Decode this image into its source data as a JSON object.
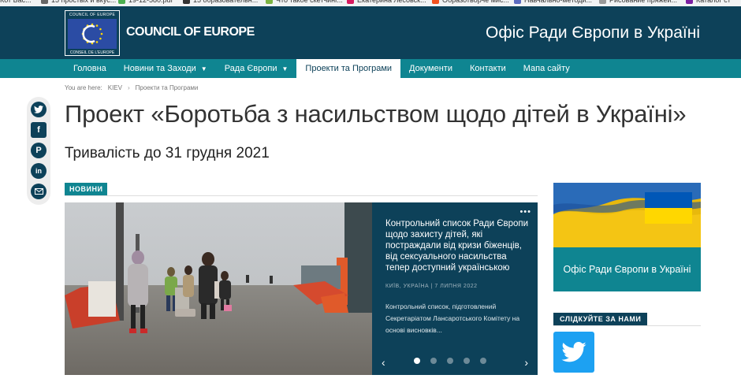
{
  "bookmarks": [
    {
      "label": "Кот Вас...",
      "color": "#888"
    },
    {
      "label": "15 простых и вкус...",
      "color": "#666"
    },
    {
      "label": "19-12-580.pdf",
      "color": "#4caf50"
    },
    {
      "label": "15 образовательн...",
      "color": "#333"
    },
    {
      "label": "Что такое скетчинг...",
      "color": "#7cb342"
    },
    {
      "label": "Екатерина Лесовск...",
      "color": "#d81b60"
    },
    {
      "label": "Образотворче мис...",
      "color": "#f4511e"
    },
    {
      "label": "Навчально-методи...",
      "color": "#5c6bc0"
    },
    {
      "label": "Рисование пряжей...",
      "color": "#999"
    },
    {
      "label": "Каталог ст",
      "color": "#7b1fa2"
    }
  ],
  "header": {
    "logo_top": "COUNCIL OF EUROPE",
    "logo_bottom": "CONSEIL DE L'EUROPE",
    "org_name": "COUNCIL OF EUROPE",
    "office_title": "Офіс Ради Європи в Україні"
  },
  "nav": {
    "items": [
      {
        "label": "Головна"
      },
      {
        "label": "Новини та Заходи"
      },
      {
        "label": "Рада Європи"
      },
      {
        "label": "Проекти та Програми"
      },
      {
        "label": "Документи"
      },
      {
        "label": "Контакти"
      },
      {
        "label": "Мапа сайту"
      }
    ],
    "caret": "▼"
  },
  "breadcrumb": {
    "prefix": "You are here:",
    "items": [
      "KIEV",
      "Проекти та Програми"
    ],
    "sep": "›"
  },
  "social": [
    "twitter-icon",
    "facebook-icon",
    "pinterest-icon",
    "linkedin-icon",
    "email-icon"
  ],
  "page": {
    "title": "Проект «Боротьба з насильством щодо дітей в Україні»",
    "duration": "Тривалість  до 31 грудня 2021"
  },
  "news": {
    "tag": "НОВИНИ",
    "menu": "•••",
    "slide_title": "Контрольний список Ради Європи щодо захисту дітей, які постраждали від кризи біженців, від сексуального насильства тепер доступний українською",
    "slide_meta": "КИЇВ, УКРАЇНА | 7 ЛИПНЯ 2022",
    "slide_desc": "Контрольний список, підготовлений Секретаріатом Лансаротського Комітету на основі висновків...",
    "prev": "‹",
    "next": "›",
    "dot_count": 5,
    "active_dot": 0
  },
  "sidebar": {
    "ua_caption": "Офіс Ради Європи в Україні",
    "follow_tag": "СЛІДКУЙТЕ ЗА НАМИ"
  },
  "colors": {
    "header_bg": "#0d4159",
    "nav_bg": "#0f8591",
    "twitter": "#1da1f2",
    "ua_blue": "#0057b7",
    "ua_yellow": "#ffd700"
  }
}
